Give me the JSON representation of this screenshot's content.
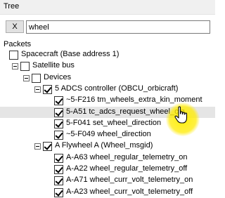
{
  "window": {
    "title": "Tree"
  },
  "toolbar": {
    "clear_label": "X"
  },
  "search": {
    "value": "wheel"
  },
  "packets_heading": "Packets",
  "tree": [
    {
      "label": "Spacecraft (Base address 1)",
      "depth": 0,
      "expander": false,
      "checked": false,
      "highlight": false
    },
    {
      "label": "Satellite bus",
      "depth": 1,
      "expander": true,
      "checked": false,
      "highlight": false
    },
    {
      "label": "Devices",
      "depth": 2,
      "expander": true,
      "checked": false,
      "highlight": false
    },
    {
      "label": "5 ADCS controller (OBCU_orbicraft)",
      "depth": 3,
      "expander": true,
      "checked": true,
      "highlight": false
    },
    {
      "label": "~5-F216 tm_wheels_extra_kin_moment",
      "depth": 4,
      "expander": false,
      "checked": true,
      "highlight": false
    },
    {
      "label": "5-A51 tc_adcs_request_wheel_cfg",
      "depth": 4,
      "expander": false,
      "checked": true,
      "highlight": true
    },
    {
      "label": "5-F041 set_wheel_direction",
      "depth": 4,
      "expander": false,
      "checked": true,
      "highlight": false
    },
    {
      "label": "~5-F049 wheel_direction",
      "depth": 4,
      "expander": false,
      "checked": true,
      "highlight": false
    },
    {
      "label": "A Flywheel A (Wheel_msgid)",
      "depth": 3,
      "expander": true,
      "checked": true,
      "highlight": false
    },
    {
      "label": "A-A63 wheel_regular_telemetry_on",
      "depth": 4,
      "expander": false,
      "checked": true,
      "highlight": false
    },
    {
      "label": "A-A22 wheel_regular_telemetry_off",
      "depth": 4,
      "expander": false,
      "checked": true,
      "highlight": false
    },
    {
      "label": "A-A71 wheel_curr_volt_telemetry_on",
      "depth": 4,
      "expander": false,
      "checked": true,
      "highlight": false
    },
    {
      "label": "A-A23 wheel_curr_volt_telemetry_off",
      "depth": 4,
      "expander": false,
      "checked": true,
      "highlight": false
    }
  ],
  "cursor": {
    "icon": "hand-pointer-icon",
    "highlight_color": "#ffeb00"
  }
}
